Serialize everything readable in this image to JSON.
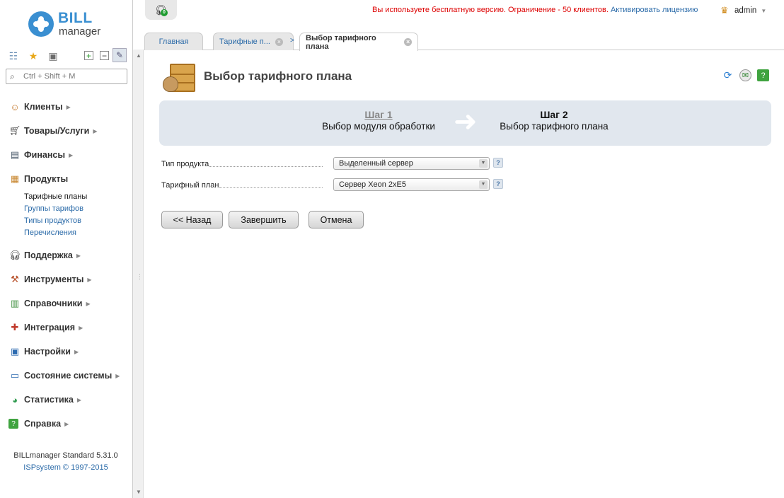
{
  "logo": {
    "brand": "BILL",
    "product": "manager"
  },
  "sidebar": {
    "search_placeholder": "Ctrl + Shift + M",
    "items": [
      {
        "label": "Клиенты"
      },
      {
        "label": "Товары/Услуги"
      },
      {
        "label": "Финансы"
      },
      {
        "label": "Продукты",
        "children": [
          "Тарифные планы",
          "Группы тарифов",
          "Типы продуктов",
          "Перечисления"
        ]
      },
      {
        "label": "Поддержка"
      },
      {
        "label": "Инструменты"
      },
      {
        "label": "Справочники"
      },
      {
        "label": "Интеграция"
      },
      {
        "label": "Настройки"
      },
      {
        "label": "Состояние системы"
      },
      {
        "label": "Статистика"
      },
      {
        "label": "Справка"
      }
    ],
    "footer": {
      "version": "BILLmanager Standard 5.31.0",
      "copyright": "ISPsystem © 1997-2015"
    }
  },
  "topbar": {
    "support_count": "0",
    "notice": "Вы используете бесплатную версию. Ограничение - 50 клиентов.",
    "notice_link": "Активировать лицензию",
    "user": "admin"
  },
  "tabs": [
    {
      "label": "Главная"
    },
    {
      "label": "Тарифные п..."
    },
    {
      "label": "Выбор тарифного плана"
    }
  ],
  "page": {
    "title": "Выбор тарифного плана",
    "wizard": {
      "steps": [
        {
          "num": "Шаг 1",
          "name": "Выбор модуля обработки",
          "state": "done"
        },
        {
          "num": "Шаг 2",
          "name": "Выбор тарифного плана",
          "state": "current"
        }
      ]
    },
    "form": {
      "fields": [
        {
          "label": "Тип продукта",
          "value": "Выделенный сервер"
        },
        {
          "label": "Тарифный план",
          "value": "Сервер Xeon 2xE5"
        }
      ]
    },
    "buttons": {
      "back": "<< Назад",
      "finish": "Завершить",
      "cancel": "Отмена"
    }
  },
  "colors": {
    "accent": "#3a8fd1",
    "notice": "#dd0000",
    "link": "#2a6aa8",
    "wizard_bg": "#e1e7ee"
  }
}
